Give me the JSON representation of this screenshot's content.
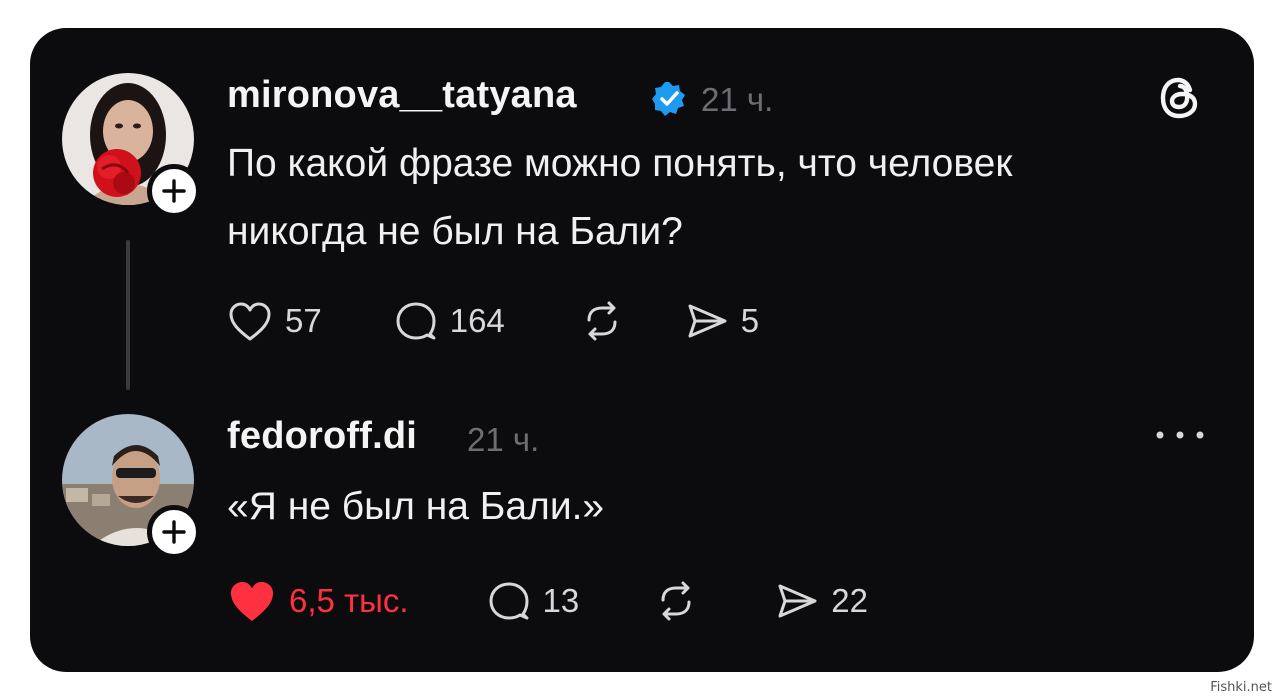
{
  "post": {
    "username": "mironova__tatyana",
    "verified": true,
    "time": "21 ч.",
    "text_line1": "По какой фразе можно понять, что человек",
    "text_line2": "никогда не был на Бали?",
    "likes": "57",
    "replies": "164",
    "shares": "5",
    "liked": false
  },
  "reply": {
    "username": "fedoroff.di",
    "time": "21 ч.",
    "text": "«Я не был на Бали.»",
    "likes": "6,5 тыс.",
    "replies": "13",
    "shares": "22",
    "liked": true
  },
  "icons": {
    "threads": "threads-logo-icon",
    "more": "more-dots-icon",
    "like": "heart-icon",
    "reply": "comment-icon",
    "repost": "repost-icon",
    "share": "send-icon",
    "follow": "plus-icon",
    "verified": "verified-check-icon"
  },
  "colors": {
    "background": "#0c0b0d",
    "text": "#f2f2f2",
    "muted": "#6e6e72",
    "liked": "#ff3040",
    "verified": "#1d9bf0"
  },
  "watermark": "Fishki.net"
}
